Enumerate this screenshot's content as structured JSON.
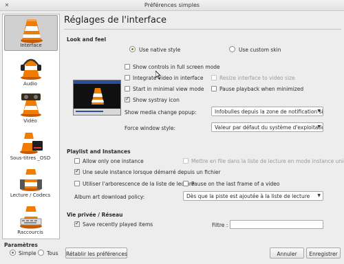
{
  "window": {
    "title": "Préférences simples"
  },
  "sidebar": {
    "items": [
      {
        "label": "Interface"
      },
      {
        "label": "Audio"
      },
      {
        "label": "Vidéo"
      },
      {
        "label": "Sous-titres _OSD"
      },
      {
        "label": "Lecture / Codecs"
      },
      {
        "label": "Raccourcis"
      }
    ]
  },
  "page": {
    "title": "Réglages de l'interface"
  },
  "look": {
    "section": "Look and feel",
    "native_style": "Use native style",
    "custom_skin": "Use custom skin",
    "full_screen_controls": "Show controls in full screen mode",
    "integrate_video": "Integrate video in interface",
    "resize_interface": "Resize interface to video size",
    "minimal_view": "Start in minimal view mode",
    "pause_minimized": "Pause playback when minimized",
    "systray": "Show systray icon",
    "media_popup_label": "Show media change popup:",
    "media_popup_value": "Infobulles depuis la zone de notification si mir",
    "window_style_label": "Force window style:",
    "window_style_value": "Valeur par défaut du système d'exploitation"
  },
  "playlist": {
    "section": "Playlist and Instances",
    "one_instance": "Allow only one instance",
    "enqueue": "Mettre en file dans la liste de lecture en mode instance unique",
    "one_instance_file": "Une seule instance lorsque démarré depuis un fichier",
    "tree": "Utiliser l'arborescence de la liste de lecture",
    "pause_last": "Pause on the last frame of a video",
    "art_label": "Album art download policy:",
    "art_value": "Dès que la piste est ajoutée à la liste de lecture"
  },
  "privacy": {
    "section": "Vie privée / Réseau",
    "recent": "Save recently played items",
    "filter_label": "Filtre :",
    "filter_value": ""
  },
  "footer": {
    "params_label": "Paramètres",
    "simple": "Simple",
    "all": "Tous",
    "reset": "Rétablir les préférences",
    "cancel": "Annuler",
    "save": "Enregistrer"
  },
  "colors": {
    "cone_orange": "#f07c00",
    "radio_dot": "#5b8c2a",
    "vlc_blue": "#2a4fa0"
  }
}
